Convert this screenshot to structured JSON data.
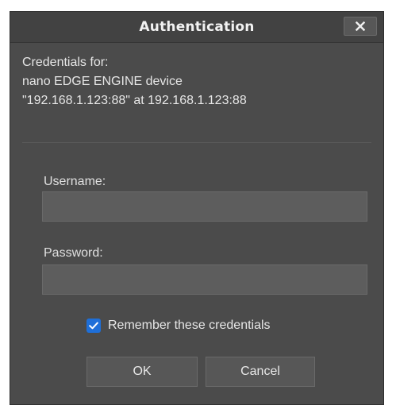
{
  "dialog": {
    "title": "Authentication",
    "close_icon": "close-icon"
  },
  "credentials": {
    "line1": "Credentials for:",
    "line2": "nano EDGE ENGINE device",
    "line3": "\"192.168.1.123:88\" at 192.168.1.123:88"
  },
  "username": {
    "label": "Username:",
    "value": "",
    "placeholder": ""
  },
  "password": {
    "label": "Password:",
    "value": "",
    "placeholder": ""
  },
  "remember": {
    "label": "Remember these credentials",
    "checked": true,
    "check_icon": "checkmark-icon"
  },
  "buttons": {
    "ok_label": "OK",
    "cancel_label": "Cancel"
  },
  "colors": {
    "dialog_bg": "#4b4b4b",
    "titlebar_bg": "#424242",
    "checkbox_accent": "#1e6fd9"
  }
}
